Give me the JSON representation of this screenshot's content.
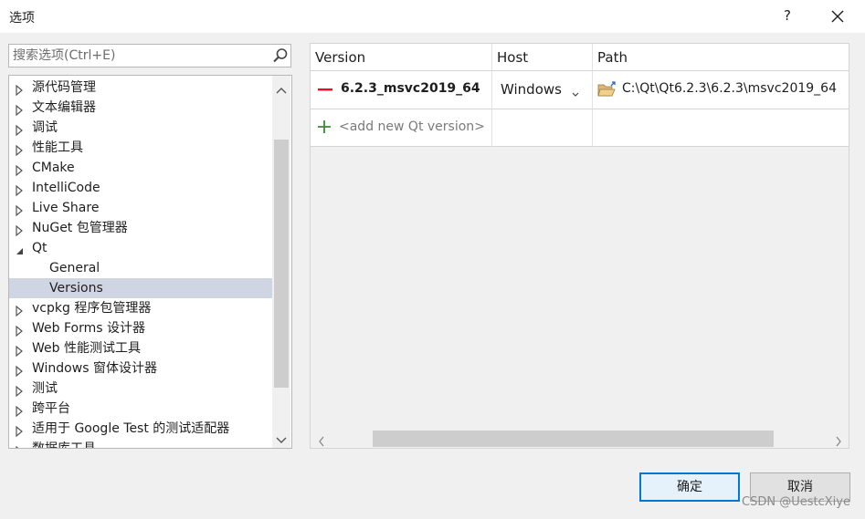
{
  "window": {
    "title": "选项",
    "help_label": "?"
  },
  "search": {
    "placeholder": "搜索选项(Ctrl+E)"
  },
  "tree": {
    "items": [
      {
        "label": "源代码管理",
        "expanded": false,
        "level": 0
      },
      {
        "label": "文本编辑器",
        "expanded": false,
        "level": 0
      },
      {
        "label": "调试",
        "expanded": false,
        "level": 0
      },
      {
        "label": "性能工具",
        "expanded": false,
        "level": 0
      },
      {
        "label": "CMake",
        "expanded": false,
        "level": 0
      },
      {
        "label": "IntelliCode",
        "expanded": false,
        "level": 0
      },
      {
        "label": "Live Share",
        "expanded": false,
        "level": 0
      },
      {
        "label": "NuGet 包管理器",
        "expanded": false,
        "level": 0
      },
      {
        "label": "Qt",
        "expanded": true,
        "level": 0
      },
      {
        "label": "General",
        "level": 1
      },
      {
        "label": "Versions",
        "level": 1,
        "selected": true
      },
      {
        "label": "vcpkg 程序包管理器",
        "expanded": false,
        "level": 0
      },
      {
        "label": "Web Forms 设计器",
        "expanded": false,
        "level": 0
      },
      {
        "label": "Web 性能测试工具",
        "expanded": false,
        "level": 0
      },
      {
        "label": "Windows 窗体设计器",
        "expanded": false,
        "level": 0
      },
      {
        "label": "测试",
        "expanded": false,
        "level": 0
      },
      {
        "label": "跨平台",
        "expanded": false,
        "level": 0
      },
      {
        "label": "适用于 Google Test 的测试适配器",
        "expanded": false,
        "level": 0
      },
      {
        "label": "数据库工具",
        "expanded": false,
        "level": 0
      }
    ]
  },
  "versions_table": {
    "columns": [
      "Version",
      "Host",
      "Path"
    ],
    "rows": [
      {
        "version": "6.2.3_msvc2019_64",
        "host": "Windows",
        "path": "C:\\Qt\\Qt6.2.3\\6.2.3\\msvc2019_64"
      }
    ],
    "add_new_label": "<add new Qt version>"
  },
  "buttons": {
    "ok": "确定",
    "cancel": "取消"
  },
  "watermark": "CSDN @UestcXiye",
  "colors": {
    "accent": "#0078d7",
    "selected_bg": "#cfd5e2",
    "remove_icon": "#e81123",
    "add_icon": "#388a34",
    "folder_icon": "#dcb67a"
  },
  "icons": {
    "close": "close-icon",
    "search": "search-icon",
    "remove": "remove-icon",
    "add": "plus-icon",
    "folder": "folder-open-icon"
  }
}
